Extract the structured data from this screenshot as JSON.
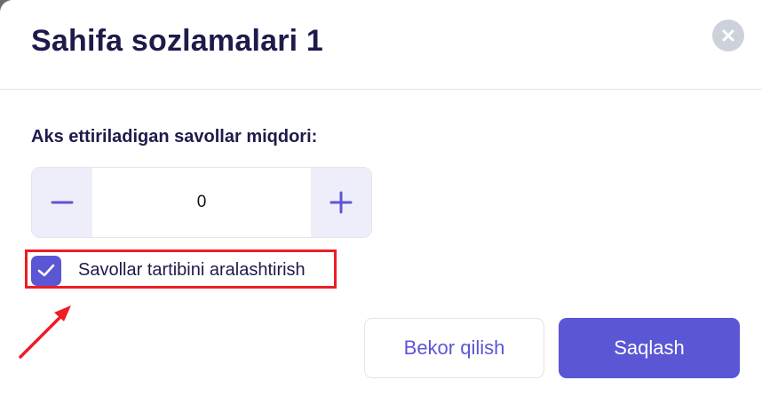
{
  "modal": {
    "title": "Sahifa sozlamalari 1"
  },
  "question_count": {
    "label": "Aks ettiriladigan savollar miqdori:",
    "value": "0"
  },
  "shuffle": {
    "label": "Savollar tartibini aralashtirish",
    "checked": true
  },
  "footer": {
    "cancel_label": "Bekor qilish",
    "save_label": "Saqlash"
  },
  "colors": {
    "accent": "#5b56d4",
    "title": "#1e1b4b",
    "annotation": "#ef1c24"
  },
  "icons": [
    "close-icon",
    "minus-icon",
    "plus-icon",
    "checkmark-icon",
    "annotation-arrow"
  ]
}
